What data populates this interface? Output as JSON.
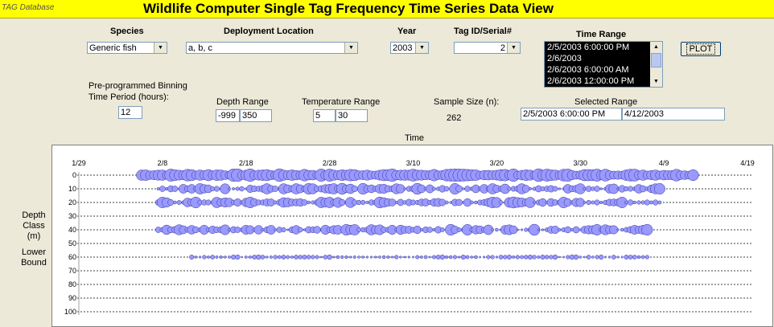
{
  "window": {
    "app_name": "TAG Database",
    "title": "Wildlife Computer Single Tag Frequency Time Series Data View"
  },
  "filters": {
    "species_label": "Species",
    "species_value": "Generic fish",
    "location_label": "Deployment Location",
    "location_value": "a, b, c",
    "year_label": "Year",
    "year_value": "2003",
    "tag_label": "Tag ID/Serial#",
    "tag_value": "2",
    "time_range_label": "Time Range",
    "time_range_items": [
      "2/5/2003 6:00:00 PM",
      "2/6/2003",
      "2/6/2003 6:00:00 AM",
      "2/6/2003 12:00:00 PM"
    ],
    "plot_label": "PLOT"
  },
  "params": {
    "binning_label_line1": "Pre-programmed Binning",
    "binning_label_line2": "Time Period (hours):",
    "binning_value": "12",
    "depth_label": "Depth Range",
    "depth_min": "-999",
    "depth_max": "350",
    "temp_label": "Temperature Range",
    "temp_min": "5",
    "temp_max": "30",
    "sample_label": "Sample Size (n):",
    "sample_value": "262",
    "selected_label": "Selected Range",
    "selected_start": "2/5/2003 6:00:00 PM",
    "selected_end": "4/12/2003"
  },
  "chart_labels": {
    "x_title": "Time",
    "y_title_line1": "Depth",
    "y_title_line2": "Class",
    "y_title_line3": "(m)",
    "y_title_line4": "Lower",
    "y_title_line5": "Bound"
  },
  "colors": {
    "titlebar": "#ffff00",
    "bubble_fill": "#9999ff",
    "bubble_stroke": "#333399",
    "list_bg": "#000000"
  },
  "chart_data": {
    "type": "scatter",
    "encoding": "bubble",
    "x_ticks": [
      "1/29",
      "2/8",
      "2/18",
      "2/28",
      "3/10",
      "3/20",
      "3/30",
      "4/9",
      "4/19"
    ],
    "x_tick_day_offsets": [
      0,
      10,
      20,
      30,
      40,
      50,
      60,
      70,
      80
    ],
    "y_ticks": [
      0,
      10,
      20,
      30,
      40,
      50,
      60,
      70,
      80,
      90,
      100
    ],
    "ylim": [
      0,
      100
    ],
    "y_inverted": true,
    "grid": "dotted horizontal lines at each depth class",
    "series": [
      {
        "depth": 0,
        "start_day": 7.5,
        "end_day": 73.5,
        "step_days": 0.5,
        "max_size": 8,
        "min_size": 5
      },
      {
        "depth": 10,
        "start_day": 9.5,
        "end_day": 69.5,
        "step_days": 0.5,
        "max_size": 7,
        "min_size": 1.2
      },
      {
        "depth": 20,
        "start_day": 9.5,
        "end_day": 69.5,
        "step_days": 0.5,
        "max_size": 7,
        "min_size": 1.5
      },
      {
        "depth": 40,
        "start_day": 9.5,
        "end_day": 68.0,
        "step_days": 0.5,
        "max_size": 7,
        "min_size": 1.2
      },
      {
        "depth": 60,
        "start_day": 13.5,
        "end_day": 68.0,
        "step_days": 0.5,
        "max_size": 3,
        "min_size": 1
      }
    ]
  }
}
